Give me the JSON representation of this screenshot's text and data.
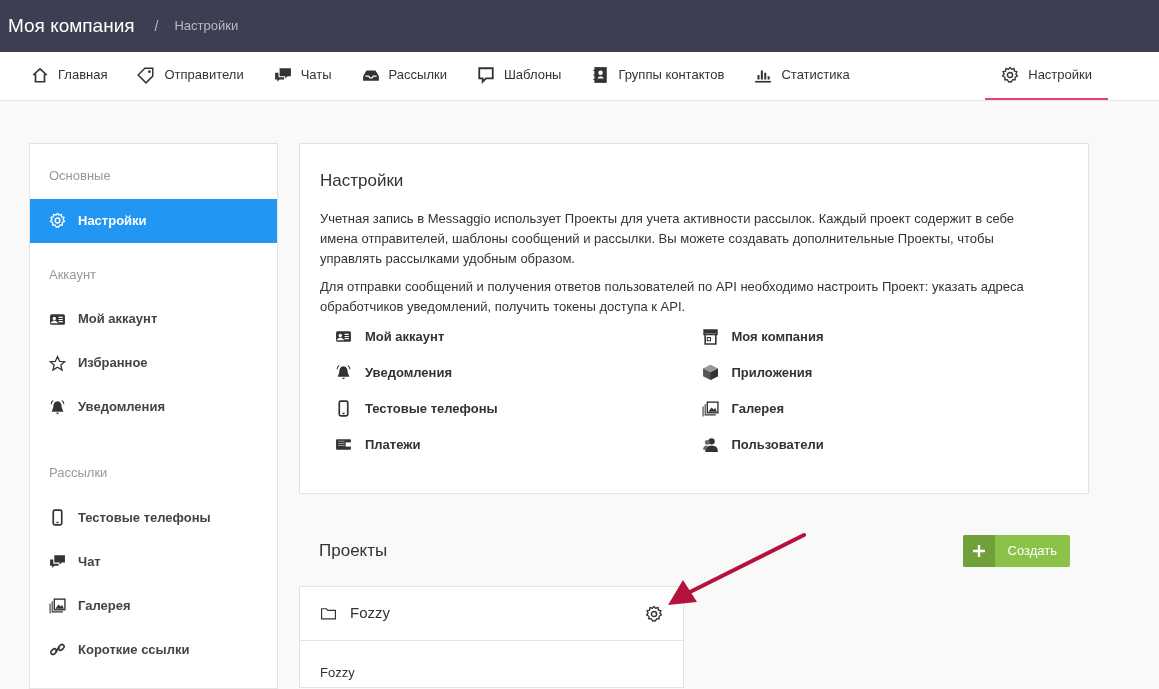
{
  "header": {
    "title": "Моя компания",
    "separator": "/",
    "breadcrumb": "Настройки"
  },
  "nav": [
    {
      "label": "Главная",
      "selected": false
    },
    {
      "label": "Отправители",
      "selected": false
    },
    {
      "label": "Чаты",
      "selected": false
    },
    {
      "label": "Рассылки",
      "selected": false
    },
    {
      "label": "Шаблоны",
      "selected": false
    },
    {
      "label": "Группы контактов",
      "selected": false
    },
    {
      "label": "Статистика",
      "selected": false
    },
    {
      "label": "Настройки",
      "selected": true
    }
  ],
  "sidebar": [
    {
      "heading": "Основные",
      "items": [
        {
          "label": "Настройки",
          "selected": true
        }
      ]
    },
    {
      "heading": "Аккаунт",
      "items": [
        {
          "label": "Мой аккаунт",
          "selected": false
        },
        {
          "label": "Избранное",
          "selected": false
        },
        {
          "label": "Уведомления",
          "selected": false
        }
      ]
    },
    {
      "heading": "Рассылки",
      "items": [
        {
          "label": "Тестовые телефоны",
          "selected": false
        },
        {
          "label": "Чат",
          "selected": false
        },
        {
          "label": "Галерея",
          "selected": false
        },
        {
          "label": "Короткие ссылки",
          "selected": false
        }
      ]
    }
  ],
  "settings_card": {
    "title": "Настройки",
    "paragraphs": [
      "Учетная запись в Messaggio использует Проекты для учета активности рассылок. Каждый проект содержит в себе имена отправителей, шаблоны сообщений и рассылки. Вы можете создавать дополнительные Проекты, чтобы управлять рассылками удобным образом.",
      "Для отправки сообщений и получения ответов пользователей по API необходимо настроить Проект: указать адреса обработчиков уведомлений, получить токены доступа к API."
    ],
    "links": [
      "Мой аккаунт",
      "Моя компания",
      "Уведомления",
      "Приложения",
      "Тестовые телефоны",
      "Галерея",
      "Платежи",
      "Пользователи"
    ]
  },
  "projects": {
    "title": "Проекты",
    "create_button": "Создать",
    "items": [
      {
        "name": "Fozzy",
        "description": "Fozzy"
      }
    ]
  }
}
